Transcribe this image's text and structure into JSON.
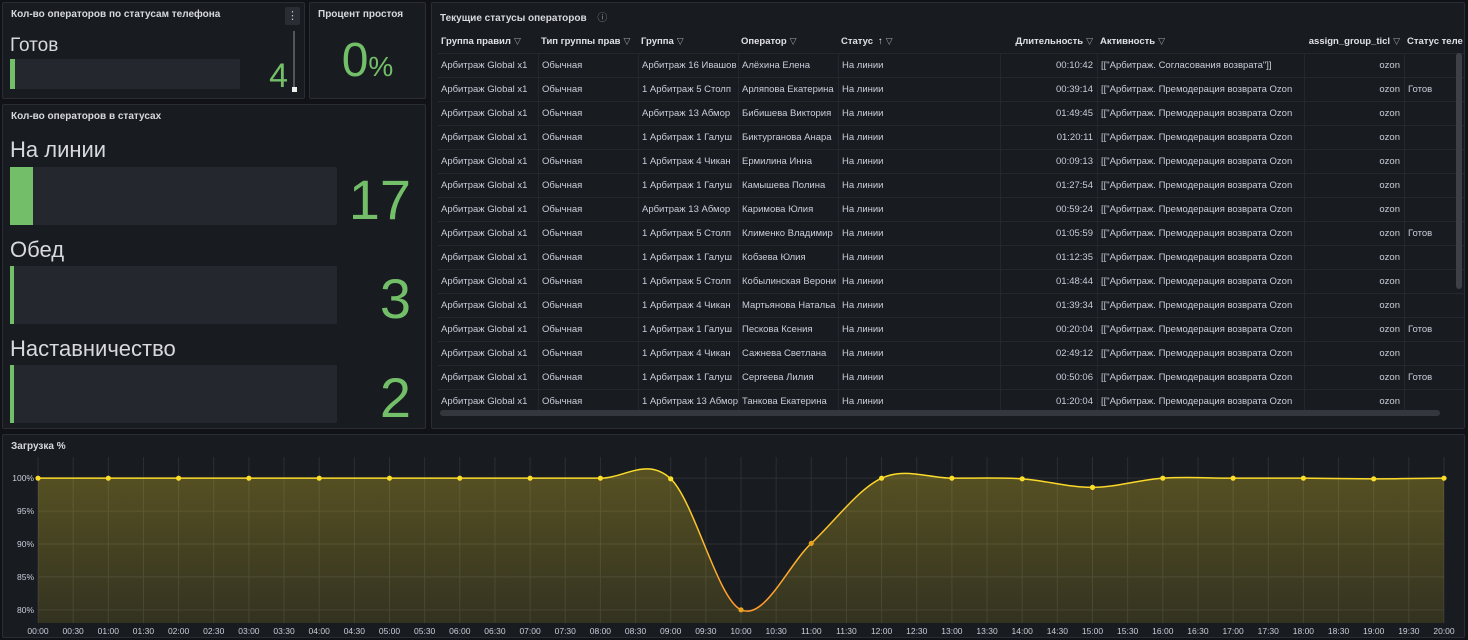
{
  "panels": {
    "phone_status": {
      "title": "Кол-во операторов по статусам телефона",
      "menu_icon": "⋮",
      "items": [
        {
          "label": "Готов",
          "value": "4",
          "fill": 0.02
        }
      ]
    },
    "idle": {
      "title": "Процент простоя",
      "value": "0",
      "unit": "%"
    },
    "operator_status": {
      "title": "Кол-во операторов в статусах",
      "items": [
        {
          "label": "На линии",
          "value": "17",
          "fill": 0.07
        },
        {
          "label": "Обед",
          "value": "3",
          "fill": 0.012
        },
        {
          "label": "Наставничество",
          "value": "2",
          "fill": 0.008
        }
      ]
    },
    "current_status": {
      "title": "Текущие статусы операторов",
      "info_icon": "ⓘ",
      "columns": [
        {
          "label": "Группа правил"
        },
        {
          "label": "Тип группы прав"
        },
        {
          "label": "Группа"
        },
        {
          "label": "Оператор"
        },
        {
          "label": "Статус",
          "sort": "↑"
        },
        {
          "label": "Длительность"
        },
        {
          "label": "Активность"
        },
        {
          "label": "assign_group_ticl"
        },
        {
          "label": "Статус теле"
        }
      ],
      "rows": [
        [
          "Арбитраж Global x1",
          "Обычная",
          "Арбитраж 16 Ивашов",
          "Алёхина Елена",
          "На линии",
          "00:10:42",
          "[[\"Арбитраж. Согласования возврата\"]]",
          "ozon",
          ""
        ],
        [
          "Арбитраж Global x1",
          "Обычная",
          "1 Арбитраж 5 Столп",
          "Арляпова Екатерина",
          "На линии",
          "00:39:14",
          "[[\"Арбитраж. Премодерация возврата Ozon",
          "ozon",
          "Готов"
        ],
        [
          "Арбитраж Global x1",
          "Обычная",
          "Арбитраж 13 Абмор",
          "Бибишева Виктория",
          "На линии",
          "01:49:45",
          "[[\"Арбитраж. Премодерация возврата Ozon",
          "ozon",
          ""
        ],
        [
          "Арбитраж Global x1",
          "Обычная",
          "1 Арбитраж 1 Галуш",
          "Биктурганова Анара",
          "На линии",
          "01:20:11",
          "[[\"Арбитраж. Премодерация возврата Ozon",
          "ozon",
          ""
        ],
        [
          "Арбитраж Global x1",
          "Обычная",
          "1 Арбитраж 4 Чикан",
          "Ермилина Инна",
          "На линии",
          "00:09:13",
          "[[\"Арбитраж. Премодерация возврата Ozon",
          "ozon",
          ""
        ],
        [
          "Арбитраж Global x1",
          "Обычная",
          "1 Арбитраж 1 Галуш",
          "Камышева Полина",
          "На линии",
          "01:27:54",
          "[[\"Арбитраж. Премодерация возврата Ozon",
          "ozon",
          ""
        ],
        [
          "Арбитраж Global x1",
          "Обычная",
          "Арбитраж 13 Абмор",
          "Каримова Юлия",
          "На линии",
          "00:59:24",
          "[[\"Арбитраж. Премодерация возврата Ozon",
          "ozon",
          ""
        ],
        [
          "Арбитраж Global x1",
          "Обычная",
          "1 Арбитраж 5 Столп",
          "Клименко Владимир",
          "На линии",
          "01:05:59",
          "[[\"Арбитраж. Премодерация возврата Ozon",
          "ozon",
          "Готов"
        ],
        [
          "Арбитраж Global x1",
          "Обычная",
          "1 Арбитраж 1 Галуш",
          "Кобзева Юлия",
          "На линии",
          "01:12:35",
          "[[\"Арбитраж. Премодерация возврата Ozon",
          "ozon",
          ""
        ],
        [
          "Арбитраж Global x1",
          "Обычная",
          "1 Арбитраж 5 Столп",
          "Кобылинская Верони",
          "На линии",
          "01:48:44",
          "[[\"Арбитраж. Премодерация возврата Ozon",
          "ozon",
          ""
        ],
        [
          "Арбитраж Global x1",
          "Обычная",
          "1 Арбитраж 4 Чикан",
          "Мартьянова Натальа",
          "На линии",
          "01:39:34",
          "[[\"Арбитраж. Премодерация возврата Ozon",
          "ozon",
          ""
        ],
        [
          "Арбитраж Global x1",
          "Обычная",
          "1 Арбитраж 1 Галуш",
          "Пескова Ксения",
          "На линии",
          "00:20:04",
          "[[\"Арбитраж. Премодерация возврата Ozon",
          "ozon",
          "Готов"
        ],
        [
          "Арбитраж Global x1",
          "Обычная",
          "1 Арбитраж 4 Чикан",
          "Сажнева Светлана",
          "На линии",
          "02:49:12",
          "[[\"Арбитраж. Премодерация возврата Ozon",
          "ozon",
          ""
        ],
        [
          "Арбитраж Global x1",
          "Обычная",
          "1 Арбитраж 1 Галуш",
          "Сергеева Лилия",
          "На линии",
          "00:50:06",
          "[[\"Арбитраж. Премодерация возврата Ozon",
          "ozon",
          "Готов"
        ],
        [
          "Арбитраж Global x1",
          "Обычная",
          "1 Арбитраж 13 Абмор",
          "Танкова Екатерина",
          "На линии",
          "01:20:04",
          "[[\"Арбитраж. Премодерация возврата Ozon",
          "ozon",
          ""
        ]
      ]
    },
    "load": {
      "title": "Загрузка %"
    }
  },
  "colors": {
    "accent_green": "#73bf69",
    "series_yellow": "#fade2a",
    "dip_orange": "#ff9830"
  },
  "chart_data": {
    "type": "line",
    "x": [
      "00:00",
      "00:30",
      "01:00",
      "01:30",
      "02:00",
      "02:30",
      "03:00",
      "03:30",
      "04:00",
      "04:30",
      "05:00",
      "05:30",
      "06:00",
      "06:30",
      "07:00",
      "07:30",
      "08:00",
      "08:30",
      "09:00",
      "09:30",
      "10:00",
      "10:30",
      "11:00",
      "11:30",
      "12:00",
      "12:30",
      "13:00",
      "13:30",
      "14:00",
      "14:30",
      "15:00",
      "15:30",
      "16:00",
      "16:30",
      "17:00",
      "17:30",
      "18:00",
      "18:30",
      "19:00",
      "19:30",
      "20:00"
    ],
    "points": [
      {
        "x": "00:00",
        "y": 100
      },
      {
        "x": "01:00",
        "y": 100
      },
      {
        "x": "02:00",
        "y": 100
      },
      {
        "x": "03:00",
        "y": 100
      },
      {
        "x": "04:00",
        "y": 100
      },
      {
        "x": "05:00",
        "y": 100
      },
      {
        "x": "06:00",
        "y": 100
      },
      {
        "x": "07:00",
        "y": 100
      },
      {
        "x": "08:00",
        "y": 100
      },
      {
        "x": "09:00",
        "y": 99.9
      },
      {
        "x": "10:00",
        "y": 80
      },
      {
        "x": "11:00",
        "y": 90.1
      },
      {
        "x": "12:00",
        "y": 100
      },
      {
        "x": "13:00",
        "y": 100
      },
      {
        "x": "14:00",
        "y": 99.9
      },
      {
        "x": "15:00",
        "y": 98.6
      },
      {
        "x": "16:00",
        "y": 100
      },
      {
        "x": "17:00",
        "y": 100
      },
      {
        "x": "18:00",
        "y": 100
      },
      {
        "x": "19:00",
        "y": 99.9
      },
      {
        "x": "20:00",
        "y": 100
      }
    ],
    "ylim": [
      78,
      102
    ],
    "yticks": [
      80,
      85,
      90,
      95,
      100
    ],
    "ytick_labels": [
      "80%",
      "85%",
      "90%",
      "95%",
      "100%"
    ],
    "grid": true
  }
}
